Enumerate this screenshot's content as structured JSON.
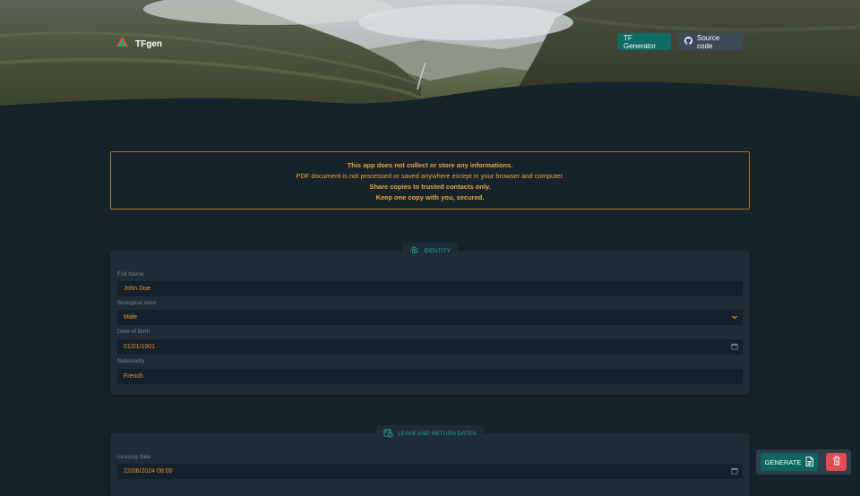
{
  "navbar": {
    "brand": "TFgen",
    "tf_generator_label": "TF Generator",
    "source_code_label": "Source code"
  },
  "notice": {
    "line1": "This app does not collect or store any informations.",
    "line2": "PDF document is not processed or saved anywhere except in your browser and computer.",
    "line3": "Share copies to trusted contacts only.",
    "line4": "Keep one copy with you, secured."
  },
  "identity": {
    "legend": "IDENTITY",
    "full_name_label": "Full Name",
    "full_name_value": "John Doe",
    "sex_label": "Biological sexe",
    "sex_value": "Male",
    "dob_label": "Date of Birth",
    "dob_value": "01/01/1901",
    "nationality_label": "Nationality",
    "nationality_value": "French"
  },
  "dates": {
    "legend": "LEAVE AND RETURN DATES",
    "leaving_label": "Leaving date",
    "leaving_value": "22/06/2024 08:00"
  },
  "actions": {
    "generate_label": "GENERATE"
  },
  "colors": {
    "background": "#17232b",
    "panel": "#1f2c36",
    "accent_teal": "#0f6b63",
    "warning": "#e9a53d",
    "value_orange": "#f0922b",
    "danger": "#e24b55"
  }
}
